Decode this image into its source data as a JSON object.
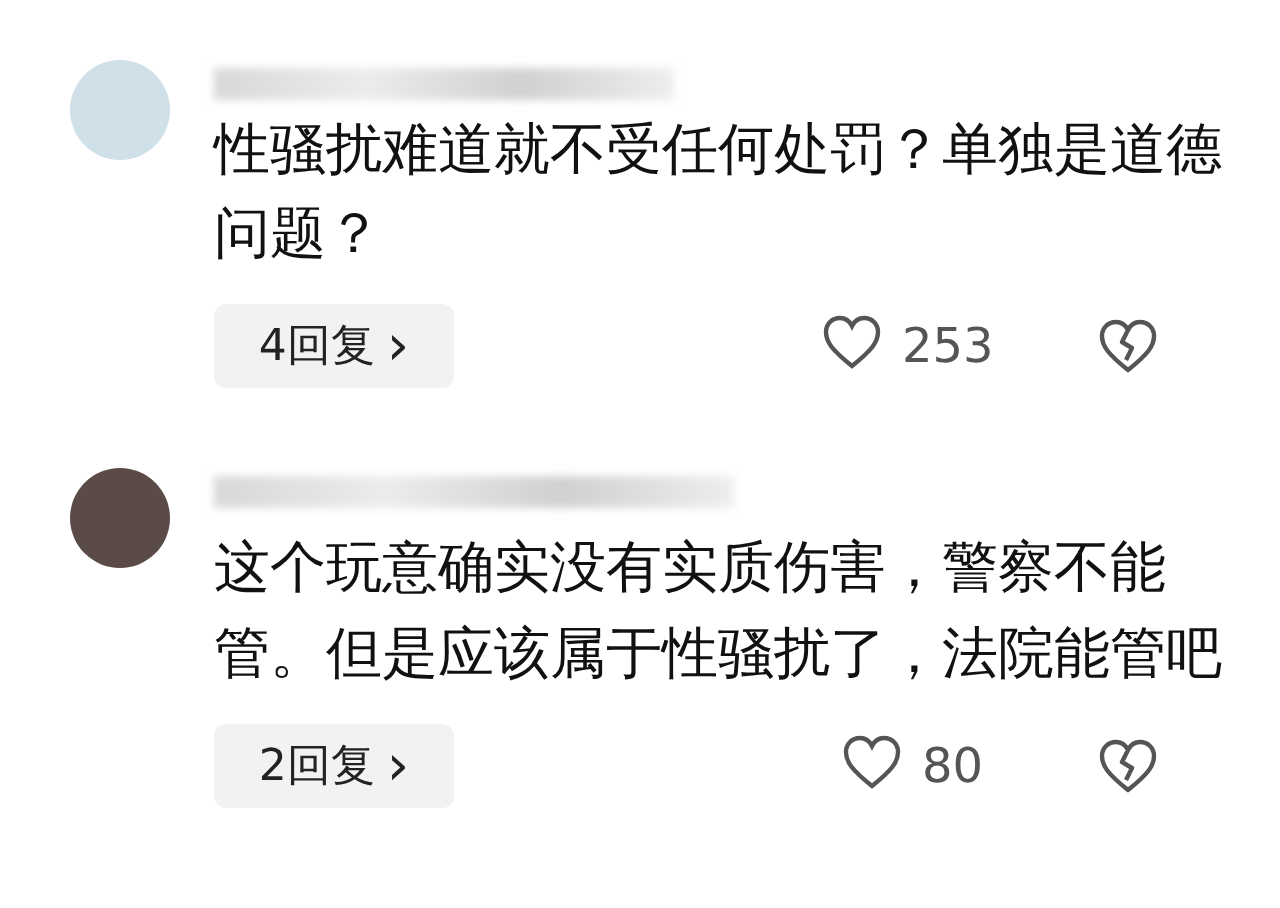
{
  "comments": [
    {
      "text": "性骚扰难道就不受任何处罚？单独是道德问题？",
      "replies": "4回复",
      "reply_arrow": "›",
      "likes": "253",
      "liked": false
    },
    {
      "text": "这个玩意确实没有实质伤害，警察不能管。但是应该属于性骚扰了，法院能管吧",
      "replies": "2回复",
      "reply_arrow": "›",
      "likes": "80",
      "liked": false
    }
  ]
}
